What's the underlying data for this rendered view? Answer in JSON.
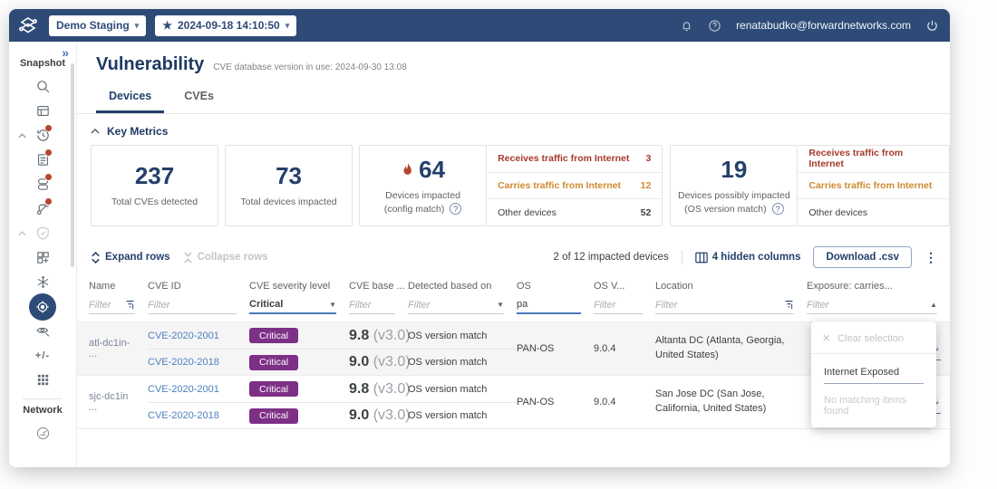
{
  "topbar": {
    "network_selector": "Demo Staging",
    "snapshot_time": "2024-09-18  14:10:50",
    "user_email": "renatabudko@forwardnetworks.com"
  },
  "sidebar": {
    "snapshot_label": "Snapshot",
    "network_label": "Network",
    "diff_icon_text": "+/-",
    "icons": [
      "search",
      "report",
      "history",
      "notes",
      "layers",
      "paths",
      "shield",
      "blocks",
      "snowflake",
      "vulnerability-active",
      "inspect",
      "diff",
      "apps",
      "gauge"
    ]
  },
  "header": {
    "title": "Vulnerability",
    "subtitle": "CVE database version in use: 2024-09-30 13:08",
    "tabs": [
      {
        "label": "Devices"
      },
      {
        "label": "CVEs"
      }
    ]
  },
  "key_metrics": {
    "section_title": "Key Metrics",
    "cards": [
      {
        "value": "237",
        "label": "Total CVEs detected"
      },
      {
        "value": "73",
        "label": "Total devices impacted"
      },
      {
        "value": "64",
        "label_line1": "Devices impacted",
        "label_line2": "(config match)"
      },
      {
        "value": "19",
        "label_line1": "Devices possibly impacted",
        "label_line2": "(OS version match)"
      }
    ],
    "breakdown_config": [
      {
        "label": "Receives traffic from Internet",
        "value": "3",
        "color": "#a6392a"
      },
      {
        "label": "Carries traffic from Internet",
        "value": "12",
        "color": "#cf8a2e"
      },
      {
        "label": "Other devices",
        "value": "52",
        "color": "#3c4043"
      }
    ],
    "breakdown_os": [
      {
        "label": "Receives traffic from Internet",
        "value": ""
      },
      {
        "label": "Carries traffic from Internet",
        "value": ""
      },
      {
        "label": "Other devices",
        "value": ""
      }
    ]
  },
  "toolbar": {
    "expand_rows": "Expand rows",
    "collapse_rows": "Collapse rows",
    "count_text": "2 of 12 impacted devices",
    "hidden_columns": "4 hidden columns",
    "download_csv": "Download .csv"
  },
  "table": {
    "columns": [
      {
        "label": "Name",
        "filter": "Filter"
      },
      {
        "label": "CVE ID",
        "filter": "Filter"
      },
      {
        "label": "CVE severity level",
        "filter": "Critical"
      },
      {
        "label": "CVE base ...",
        "filter": "Filter"
      },
      {
        "label": "Detected based on",
        "filter": "Filter"
      },
      {
        "label": "OS",
        "filter": "pa"
      },
      {
        "label": "OS V...",
        "filter": "Filter"
      },
      {
        "label": "Location",
        "filter": "Filter"
      },
      {
        "label": "Exposure: carries...",
        "filter": "Filter"
      }
    ],
    "rows": [
      {
        "name": "atl-dc1in- ...",
        "os": "PAN-OS",
        "os_version": "9.0.4",
        "location": "Altanta DC (Atlanta, Georgia, United States)",
        "cves": [
          {
            "id": "CVE-2020-2001",
            "severity": "Critical",
            "score": "9.8",
            "score_ver": "(v3.0)",
            "detected": "OS version match"
          },
          {
            "id": "CVE-2020-2018",
            "severity": "Critical",
            "score": "9.0",
            "score_ver": "(v3.0)",
            "detected": "OS version match"
          }
        ]
      },
      {
        "name": "sjc-dc1in ...",
        "os": "PAN-OS",
        "os_version": "9.0.4",
        "location": "San Jose DC (San Jose, California, United States)",
        "cves": [
          {
            "id": "CVE-2020-2001",
            "severity": "Critical",
            "score": "9.8",
            "score_ver": "(v3.0)",
            "detected": "OS version match"
          },
          {
            "id": "CVE-2020-2018",
            "severity": "Critical",
            "score": "9.0",
            "score_ver": "(v3.0)",
            "detected": "OS version match"
          }
        ]
      }
    ]
  },
  "exposure_dropdown": {
    "clear_label": "Clear selection",
    "option": "Internet Exposed",
    "empty_text": "No matching items found"
  },
  "colors": {
    "topbar": "#2e4b77",
    "title_navy": "#1e3a63",
    "link_blue": "#4d7fbe",
    "severity_critical": "#7d3086",
    "flame_red": "#b5452c",
    "receives_red": "#a6392a",
    "carries_orange": "#cf8a2e"
  }
}
